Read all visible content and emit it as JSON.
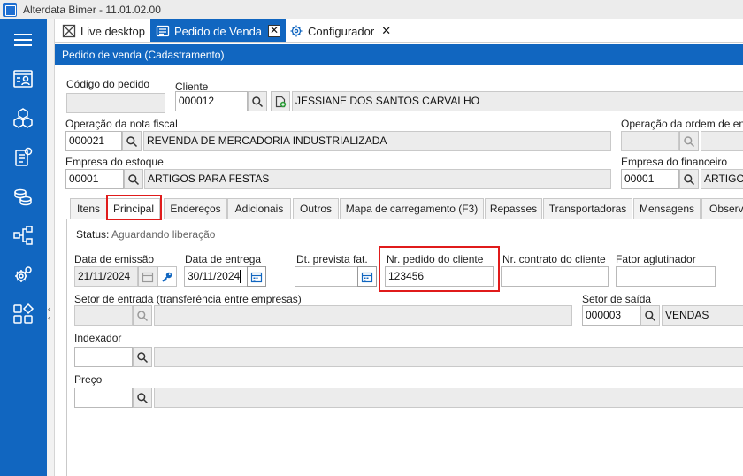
{
  "app": {
    "title": "Alterdata Bimer - 11.01.02.00"
  },
  "colors": {
    "accent": "#1166c0",
    "highlight": "#e01b1b"
  },
  "sidebar": {
    "items": [
      {
        "icon": "hamburger-menu-icon"
      },
      {
        "icon": "contact-card-icon"
      },
      {
        "icon": "cubes-icon"
      },
      {
        "icon": "invoice-icon"
      },
      {
        "icon": "coins-icon"
      },
      {
        "icon": "network-icon"
      },
      {
        "icon": "settings-gears-icon"
      },
      {
        "icon": "apps-grid-icon"
      }
    ]
  },
  "doctabs": [
    {
      "label": "Live desktop",
      "icon": "live-desktop-icon"
    },
    {
      "label": "Pedido de Venda",
      "icon": "order-list-icon",
      "active": true,
      "close": "✕"
    },
    {
      "label": "Configurador",
      "icon": "configurator-gear-icon",
      "close": "✕"
    }
  ],
  "form": {
    "header": "Pedido de venda (Cadastramento)",
    "codigo_pedido": {
      "label": "Código do pedido",
      "value": ""
    },
    "cliente": {
      "label": "Cliente",
      "code": "000012",
      "name": "JESSIANE DOS SANTOS CARVALHO"
    },
    "operacao_nf": {
      "label": "Operação da nota fiscal",
      "code": "000021",
      "name": "REVENDA DE MERCADORIA INDUSTRIALIZADA"
    },
    "operacao_ordem": {
      "label": "Operação da ordem de ent",
      "code": "",
      "name": ""
    },
    "empresa_estoque": {
      "label": "Empresa do estoque",
      "code": "00001",
      "name": "ARTIGOS PARA FESTAS"
    },
    "empresa_financeiro": {
      "label": "Empresa do financeiro",
      "code": "00001",
      "name": "ARTIGOS"
    }
  },
  "subtabs": [
    "Itens",
    "Principal",
    "Endereços",
    "Adicionais",
    "Outros",
    "Mapa de carregamento (F3)",
    "Repasses",
    "Transportadoras",
    "Mensagens",
    "Observa"
  ],
  "principal": {
    "status_label": "Status:",
    "status_value": "Aguardando liberação",
    "data_emissao": {
      "label": "Data de emissão",
      "value": "21/11/2024"
    },
    "data_entrega": {
      "label": "Data de entrega",
      "value": "30/11/2024"
    },
    "dt_prevista": {
      "label": "Dt. prevista fat.",
      "value": ""
    },
    "nr_pedido_cliente": {
      "label": "Nr. pedido do cliente",
      "value": "123456"
    },
    "nr_contrato": {
      "label": "Nr. contrato do cliente",
      "value": ""
    },
    "fator_aglutinador": {
      "label": "Fator aglutinador",
      "value": ""
    },
    "setor_entrada": {
      "label": "Setor de entrada (transferência entre empresas)",
      "code": "",
      "name": ""
    },
    "setor_saida": {
      "label": "Setor de saída",
      "code": "000003",
      "name": "VENDAS"
    },
    "indexador": {
      "label": "Indexador",
      "code": "",
      "name": ""
    },
    "preco": {
      "label": "Preço",
      "code": "",
      "name": ""
    }
  }
}
